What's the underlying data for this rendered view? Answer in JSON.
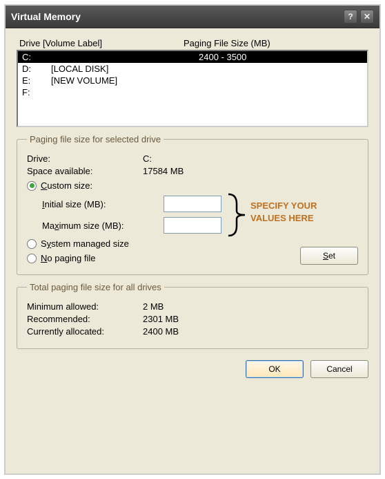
{
  "window": {
    "title": "Virtual Memory"
  },
  "drive_list": {
    "header_col1": "Drive  [Volume Label]",
    "header_col2": "Paging File Size (MB)",
    "rows": [
      {
        "letter": "C:",
        "label": "",
        "size": "2400 - 3500",
        "selected": true
      },
      {
        "letter": "D:",
        "label": "[LOCAL DISK]",
        "size": "",
        "selected": false
      },
      {
        "letter": "E:",
        "label": "[NEW VOLUME]",
        "size": "",
        "selected": false
      },
      {
        "letter": "F:",
        "label": "",
        "size": "",
        "selected": false
      }
    ]
  },
  "selected_group": {
    "legend": "Paging file size for selected drive",
    "drive_label": "Drive:",
    "drive_value": "C:",
    "space_label": "Space available:",
    "space_value": "17584 MB",
    "custom_label": "Custom size:",
    "custom_underline": "C",
    "initial_label": "Initial size (MB):",
    "initial_underline": "I",
    "initial_value": "",
    "max_label": "Maximum size (MB):",
    "max_underline": "x",
    "max_value": "",
    "system_label": "System managed size",
    "system_underline": "y",
    "nopaging_label": "No paging file",
    "nopaging_underline": "N",
    "set_label": "Set",
    "set_underline": "S",
    "mode": "custom"
  },
  "total_group": {
    "legend": "Total paging file size for all drives",
    "min_label": "Minimum allowed:",
    "min_value": "2 MB",
    "rec_label": "Recommended:",
    "rec_value": "2301 MB",
    "cur_label": "Currently allocated:",
    "cur_value": "2400 MB"
  },
  "footer": {
    "ok": "OK",
    "cancel": "Cancel"
  },
  "annotation": {
    "line1": "SPECIFY YOUR",
    "line2": "VALUES HERE"
  },
  "icons": {
    "help": "?",
    "close": "✕"
  }
}
